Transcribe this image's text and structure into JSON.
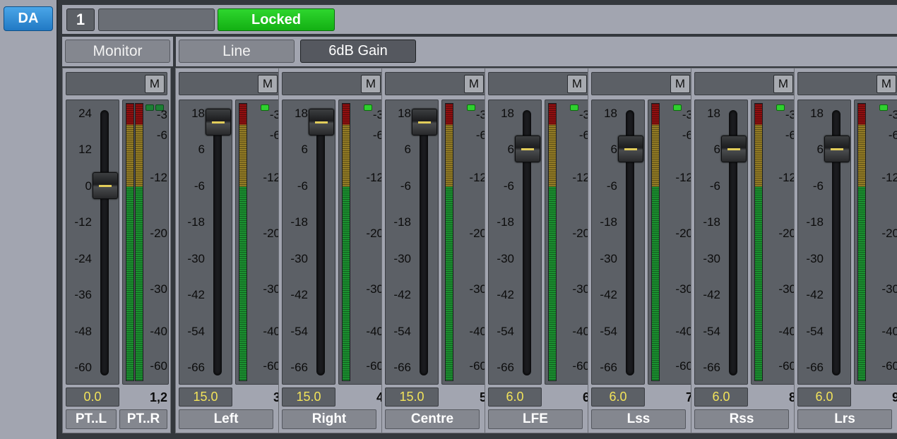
{
  "sidebar": {
    "da_label": "DA"
  },
  "header": {
    "slot_number": "1",
    "slot_name": "",
    "lock_status": "Locked"
  },
  "controls": {
    "monitor_label": "Monitor",
    "line_label": "Line",
    "gain_label": "6dB Gain"
  },
  "colors": {
    "lock_green": "#13b013",
    "da_blue": "#2179c4",
    "gain_text": "#f2e35a",
    "meter_red": "#8e0f10",
    "meter_amber": "#917a25",
    "meter_green": "#1b9030"
  },
  "meter_scale": [
    "-3",
    "-6",
    "-12",
    "-20",
    "-30",
    "-40",
    "-60"
  ],
  "channels": [
    {
      "mute_label": "M",
      "fader_scale": [
        "24",
        "12",
        "0",
        "-12",
        "-24",
        "-36",
        "-48",
        "-60"
      ],
      "fader_level_db": 0,
      "gain_value": "0.0",
      "channel_number": "1,2",
      "names": [
        "PT..L",
        "PT..R"
      ],
      "stereo": true
    },
    {
      "mute_label": "M",
      "fader_scale": [
        "18",
        "6",
        "-6",
        "-18",
        "-30",
        "-42",
        "-54",
        "-66"
      ],
      "fader_level_db": 15,
      "gain_value": "15.0",
      "channel_number": "3",
      "names": [
        "Left"
      ],
      "stereo": false
    },
    {
      "mute_label": "M",
      "fader_scale": [
        "18",
        "6",
        "-6",
        "-18",
        "-30",
        "-42",
        "-54",
        "-66"
      ],
      "fader_level_db": 15,
      "gain_value": "15.0",
      "channel_number": "4",
      "names": [
        "Right"
      ],
      "stereo": false
    },
    {
      "mute_label": "M",
      "fader_scale": [
        "18",
        "6",
        "-6",
        "-18",
        "-30",
        "-42",
        "-54",
        "-66"
      ],
      "fader_level_db": 15,
      "gain_value": "15.0",
      "channel_number": "5",
      "names": [
        "Centre"
      ],
      "stereo": false
    },
    {
      "mute_label": "M",
      "fader_scale": [
        "18",
        "6",
        "-6",
        "-18",
        "-30",
        "-42",
        "-54",
        "-66"
      ],
      "fader_level_db": 6,
      "gain_value": "6.0",
      "channel_number": "6",
      "names": [
        "LFE"
      ],
      "stereo": false
    },
    {
      "mute_label": "M",
      "fader_scale": [
        "18",
        "6",
        "-6",
        "-18",
        "-30",
        "-42",
        "-54",
        "-66"
      ],
      "fader_level_db": 6,
      "gain_value": "6.0",
      "channel_number": "7",
      "names": [
        "Lss"
      ],
      "stereo": false
    },
    {
      "mute_label": "M",
      "fader_scale": [
        "18",
        "6",
        "-6",
        "-18",
        "-30",
        "-42",
        "-54",
        "-66"
      ],
      "fader_level_db": 6,
      "gain_value": "6.0",
      "channel_number": "8",
      "names": [
        "Rss"
      ],
      "stereo": false
    },
    {
      "mute_label": "M",
      "fader_scale": [
        "18",
        "6",
        "-6",
        "-18",
        "-30",
        "-42",
        "-54",
        "-66"
      ],
      "fader_level_db": 6,
      "gain_value": "6.0",
      "channel_number": "9",
      "names": [
        "Lrs"
      ],
      "stereo": false
    }
  ]
}
